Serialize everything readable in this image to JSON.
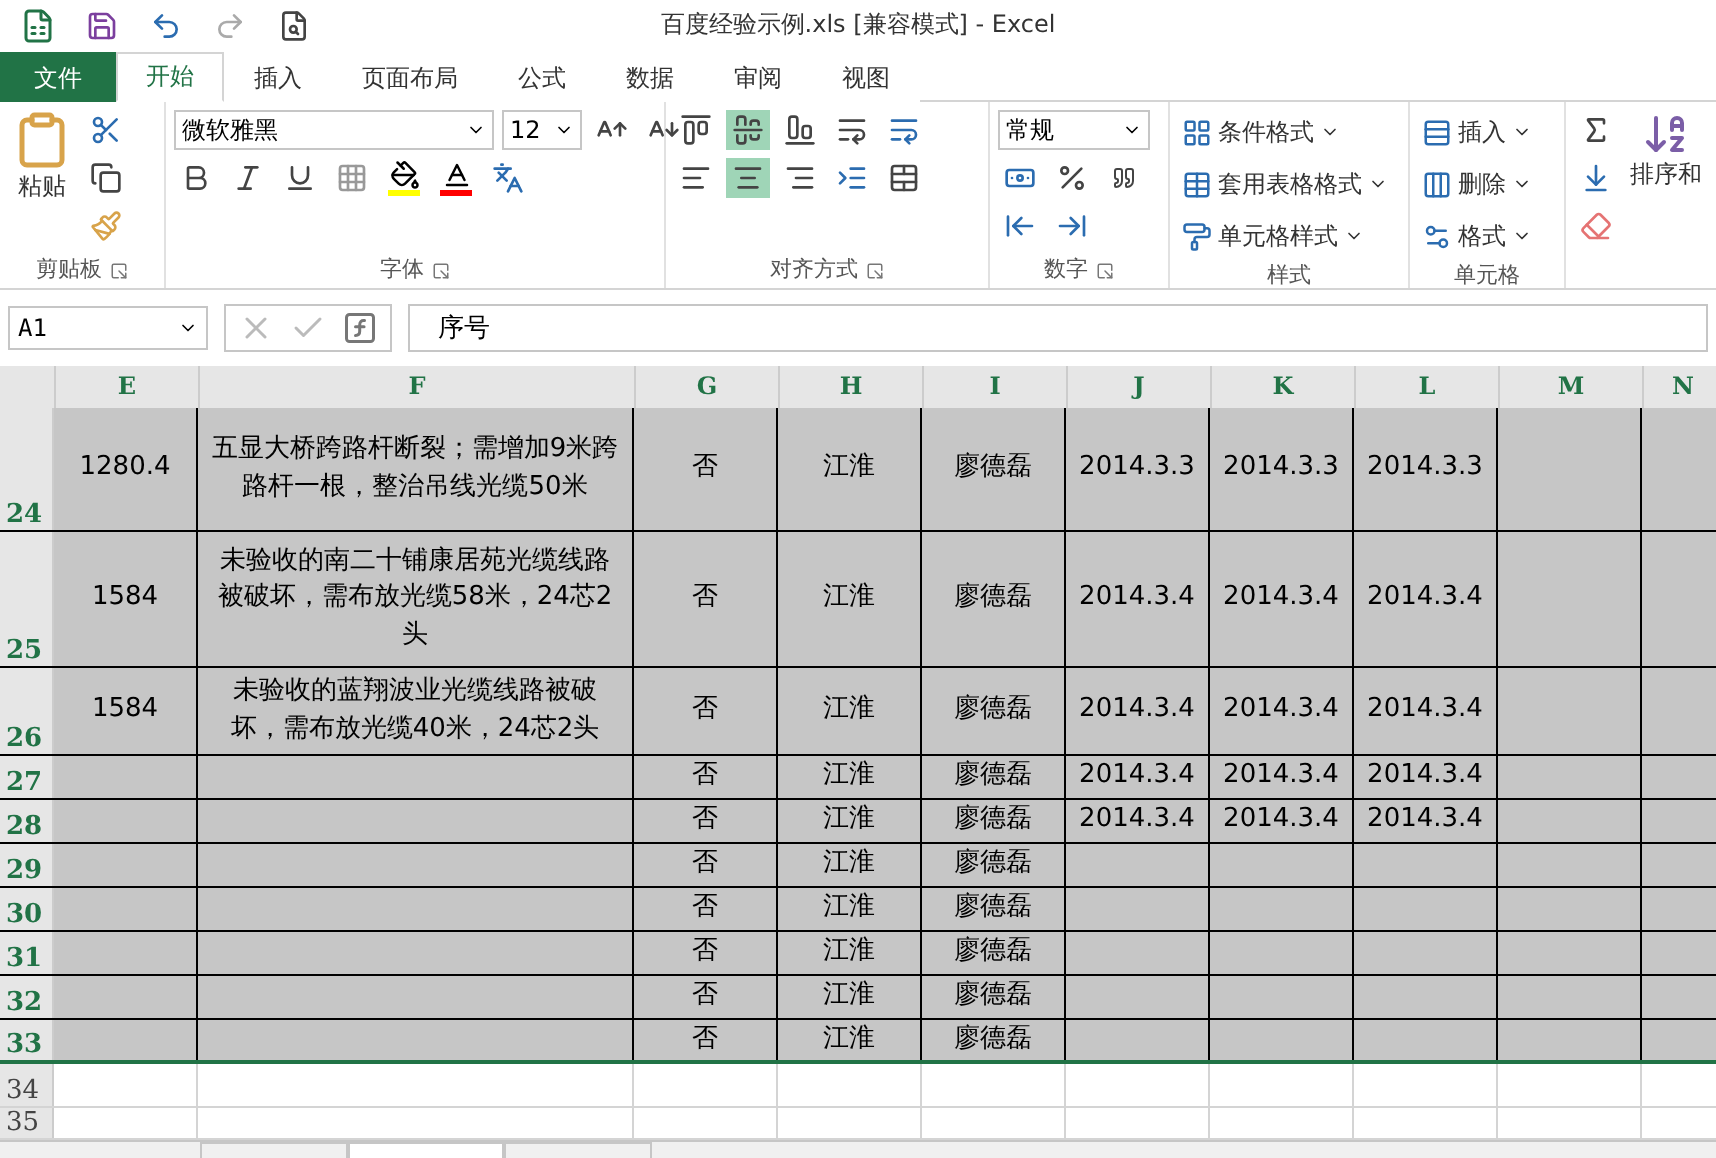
{
  "title": "百度经验示例.xls  [兼容模式] - Excel",
  "tabs": [
    {
      "label": "文件",
      "kind": "file",
      "selected": false
    },
    {
      "label": "开始",
      "kind": "tab",
      "selected": true
    },
    {
      "label": "插入",
      "kind": "tab",
      "selected": false
    },
    {
      "label": "页面布局",
      "kind": "tab",
      "selected": false
    },
    {
      "label": "公式",
      "kind": "tab",
      "selected": false
    },
    {
      "label": "数据",
      "kind": "tab",
      "selected": false
    },
    {
      "label": "审阅",
      "kind": "tab",
      "selected": false
    },
    {
      "label": "视图",
      "kind": "tab",
      "selected": false
    }
  ],
  "ribbon": {
    "clipboard": {
      "label": "剪贴板",
      "paste": "粘贴"
    },
    "font": {
      "label": "字体",
      "name": "微软雅黑",
      "size": "12"
    },
    "alignment": {
      "label": "对齐方式",
      "buttons": [
        {
          "kind": "top",
          "on": false
        },
        {
          "kind": "middle",
          "on": true
        },
        {
          "kind": "bottom",
          "on": false
        },
        {
          "kind": "left",
          "on": false
        },
        {
          "kind": "center",
          "on": true
        },
        {
          "kind": "right",
          "on": false
        }
      ]
    },
    "number": {
      "label": "数字",
      "format": "常规"
    },
    "styles": {
      "label": "样式",
      "items": [
        "条件格式",
        "套用表格格式",
        "单元格样式"
      ]
    },
    "cells": {
      "label": "单元格",
      "items": [
        "插入",
        "删除",
        "格式"
      ]
    },
    "editing": {
      "sort": "排序和"
    }
  },
  "formula_bar": {
    "name_box": "A1",
    "formula": "序号"
  },
  "columns": [
    {
      "label": "E"
    },
    {
      "label": "F"
    },
    {
      "label": "G"
    },
    {
      "label": "H"
    },
    {
      "label": "I"
    },
    {
      "label": "J"
    },
    {
      "label": "K"
    },
    {
      "label": "L"
    },
    {
      "label": "M"
    },
    {
      "label": "N"
    }
  ],
  "rows": [
    {
      "header": "24",
      "filled": true,
      "cells": {
        "E": "1280.4",
        "F": "五显大桥跨路杆断裂；需增加9米跨路杆一根，整治吊线光缆50米",
        "G": "否",
        "H": "江淮",
        "I": "廖德磊",
        "J": "2014.3.3",
        "K": "2014.3.3",
        "L": "2014.3.3"
      }
    },
    {
      "header": "25",
      "filled": true,
      "cells": {
        "E": "1584",
        "F": "未验收的南二十铺康居苑光缆线路被破坏，需布放光缆58米，24芯2头",
        "G": "否",
        "H": "江淮",
        "I": "廖德磊",
        "J": "2014.3.4",
        "K": "2014.3.4",
        "L": "2014.3.4"
      }
    },
    {
      "header": "26",
      "filled": true,
      "cells": {
        "E": "1584",
        "F": "未验收的蓝翔波业光缆线路被破坏，需布放光缆40米，24芯2头",
        "G": "否",
        "H": "江淮",
        "I": "廖德磊",
        "J": "2014.3.4",
        "K": "2014.3.4",
        "L": "2014.3.4"
      }
    },
    {
      "header": "27",
      "filled": true,
      "cells": {
        "G": "否",
        "H": "江淮",
        "I": "廖德磊",
        "J": "2014.3.4",
        "K": "2014.3.4",
        "L": "2014.3.4"
      }
    },
    {
      "header": "28",
      "filled": true,
      "cells": {
        "G": "否",
        "H": "江淮",
        "I": "廖德磊",
        "J": "2014.3.4",
        "K": "2014.3.4",
        "L": "2014.3.4"
      }
    },
    {
      "header": "29",
      "filled": true,
      "cells": {
        "G": "否",
        "H": "江淮",
        "I": "廖德磊"
      }
    },
    {
      "header": "30",
      "filled": true,
      "cells": {
        "G": "否",
        "H": "江淮",
        "I": "廖德磊"
      }
    },
    {
      "header": "31",
      "filled": true,
      "cells": {
        "G": "否",
        "H": "江淮",
        "I": "廖德磊"
      }
    },
    {
      "header": "32",
      "filled": true,
      "cells": {
        "G": "否",
        "H": "江淮",
        "I": "廖德磊"
      }
    },
    {
      "header": "33",
      "filled": true,
      "cells": {
        "G": "否",
        "H": "江淮",
        "I": "廖德磊"
      }
    },
    {
      "header": "34",
      "filled": false,
      "cells": {}
    },
    {
      "header": "35",
      "filled": false,
      "cells": {}
    }
  ],
  "sheet_tabs": [
    {
      "selected": false
    },
    {
      "selected": true
    },
    {
      "selected": false
    }
  ]
}
